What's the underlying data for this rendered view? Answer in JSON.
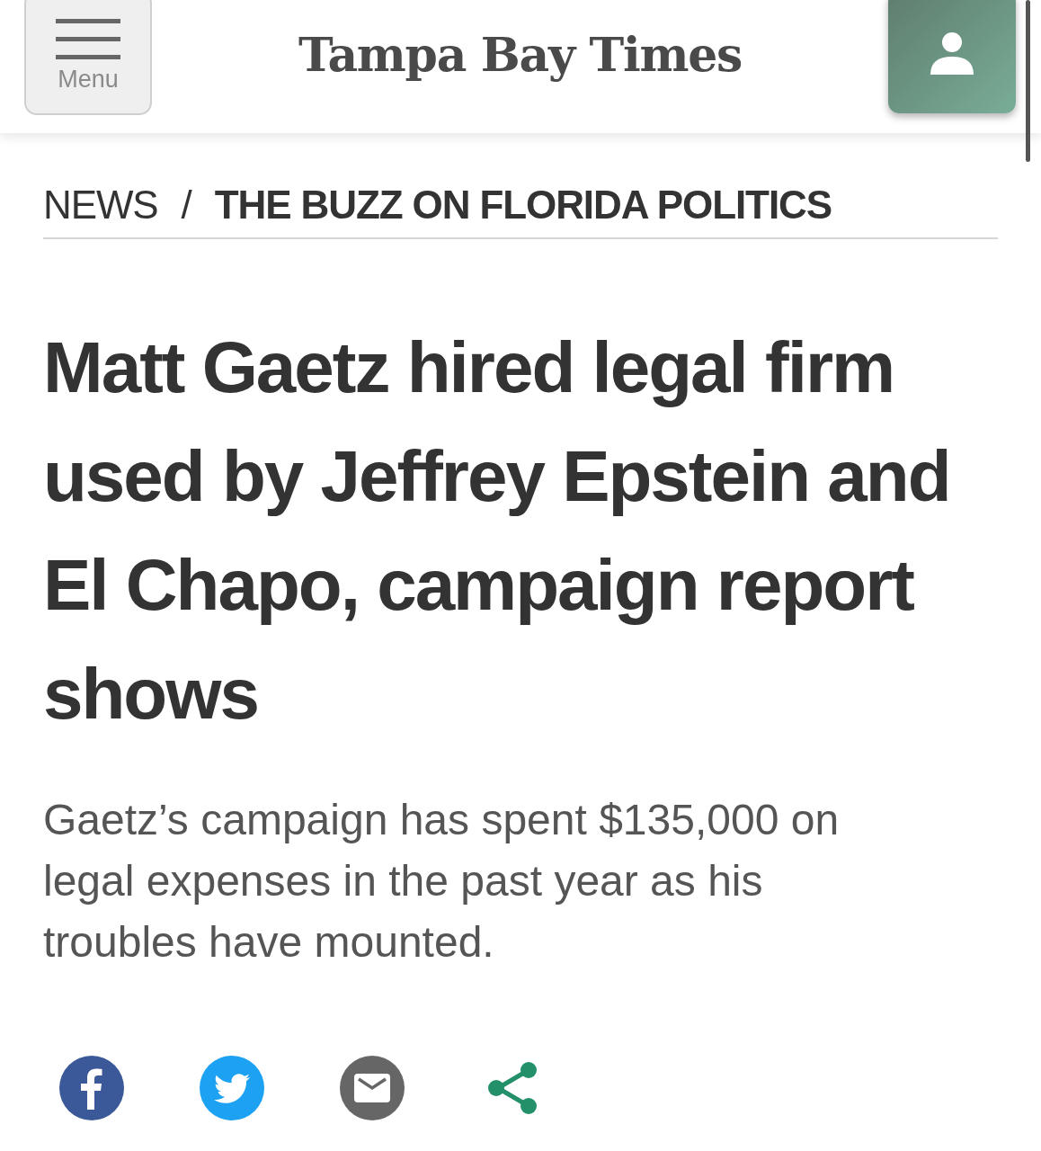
{
  "header": {
    "menu_label": "Menu",
    "logo": "Tampa Bay Times"
  },
  "breadcrumb": [
    {
      "label": "NEWS",
      "current": false
    },
    {
      "label": "THE BUZZ ON FLORIDA POLITICS",
      "current": true
    }
  ],
  "breadcrumb_separator": "/",
  "headline": "Matt Gaetz hired legal firm used by Jeffrey Epstein and El Chapo, campaign report shows",
  "summary": "Gaetz’s campaign has spent $135,000 on legal expenses in the past year as his troubles have mounted.",
  "share_buttons": [
    {
      "kind": "facebook"
    },
    {
      "kind": "twitter"
    },
    {
      "kind": "email"
    },
    {
      "kind": "share"
    }
  ]
}
